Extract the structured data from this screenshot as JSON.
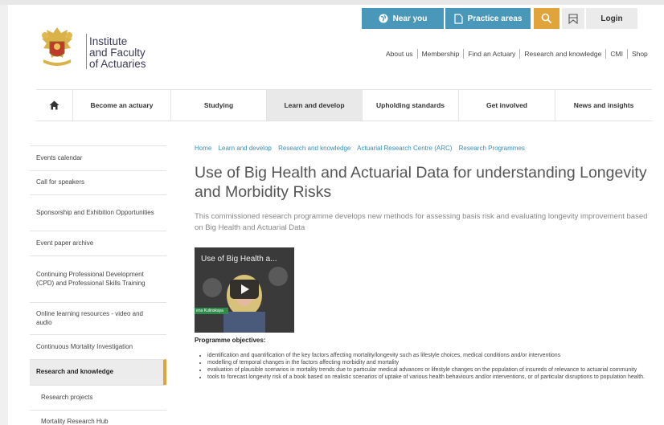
{
  "logo": {
    "name_line1": "Institute",
    "name_line2": "and Faculty",
    "name_line3": "of Actuaries"
  },
  "utility": {
    "near_you": "Near you",
    "practice_areas": "Practice areas",
    "login": "Login",
    "search_icon": "search-icon",
    "bookmark_icon": "bookmark-icon"
  },
  "top_links": [
    "About us",
    "Membership",
    "Find an Actuary",
    "Research and knowledge",
    "CMI",
    "Shop"
  ],
  "nav": {
    "home_icon": "home-icon",
    "items": [
      "Become an actuary",
      "Studying",
      "Learn and develop",
      "Upholding standards",
      "Get involved",
      "News and insights"
    ]
  },
  "sidebar": {
    "items": [
      "Events calendar",
      "Call for speakers",
      "Sponsorship and Exhibition Opportunities",
      "Event paper archive",
      "Continuing Professional Development (CPD) and Professional Skills Training",
      "Online learning resources - video and audio",
      "Continuous Mortality Investigation",
      "Research and knowledge",
      "Research projects",
      "Mortality Research Hub"
    ]
  },
  "breadcrumb": [
    "Home",
    "Learn and develop",
    "Research and knowledge",
    "Actuarial Research Centre (ARC)",
    "Research Programmes"
  ],
  "title": "Use of Big Health and Actuarial Data for understanding Longevity and Morbidity Risks",
  "intro": "This commissioned research programme develops new methods for assessing basis risk and evaluating longevity improvement based on Big Health and Actuarial Data",
  "video": {
    "title": "Use of Big Health a...",
    "lower_third": "ena Kulinskaya"
  },
  "objectives_heading": "Programme objectives:",
  "objectives": [
    "identification and quantification of the key factors affecting mortality/longevity such as lifestyle choices, medical conditions and/or interventions",
    "modelling of temporal changes in the factors affecting morbidity and mortality",
    "evaluation of plausible scenarios in mortality trends due to particular medical advances or lifestyle changes on the population of insureds of relevance to actuarial community",
    "tools to forecast longevity risk of a book based on realistic scenarios of uptake of various health behaviours and/or interventions, or of particular disruptions to population health."
  ],
  "colors": {
    "accent_blue": "#4a98b9",
    "accent_gold": "#e0a43a",
    "link_blue": "#3a8fb4"
  }
}
